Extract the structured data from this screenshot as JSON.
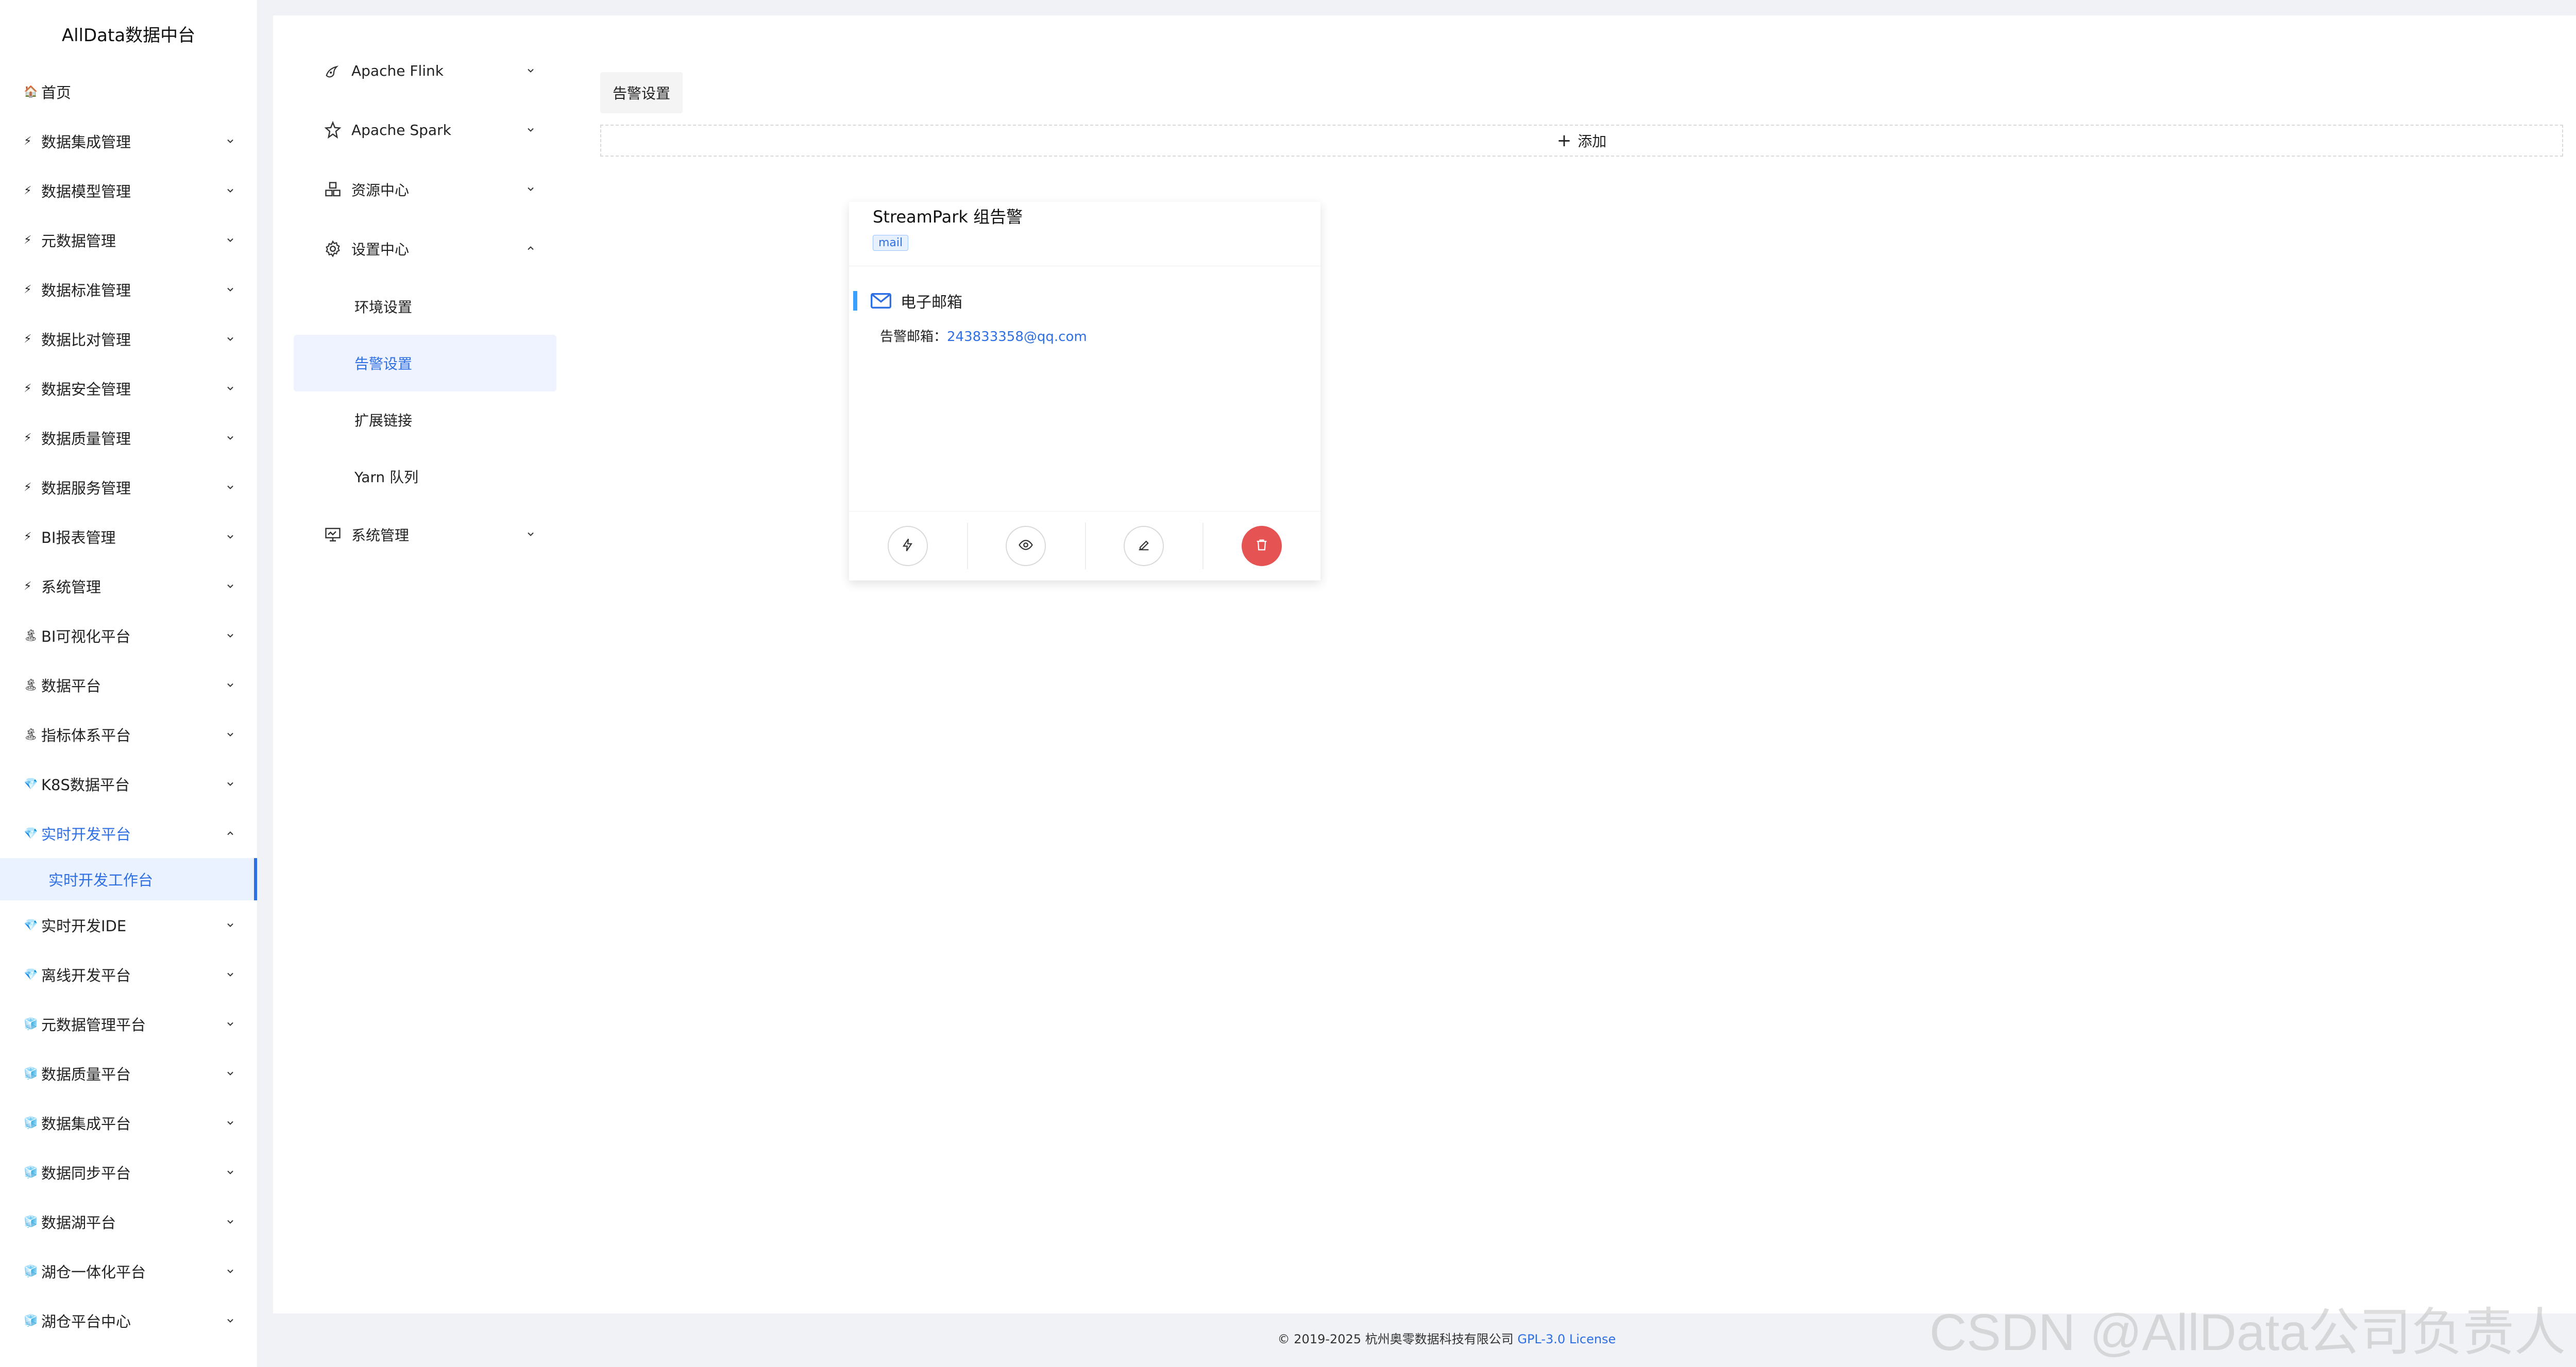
{
  "brand": "AllData数据中台",
  "sidebar": {
    "items": [
      {
        "label": "首页",
        "icon": "🏠",
        "has_chevron": false
      },
      {
        "label": "数据集成管理",
        "icon": "⚡",
        "has_chevron": true
      },
      {
        "label": "数据模型管理",
        "icon": "⚡",
        "has_chevron": true
      },
      {
        "label": "元数据管理",
        "icon": "⚡",
        "has_chevron": true
      },
      {
        "label": "数据标准管理",
        "icon": "⚡",
        "has_chevron": true
      },
      {
        "label": "数据比对管理",
        "icon": "⚡",
        "has_chevron": true
      },
      {
        "label": "数据安全管理",
        "icon": "⚡",
        "has_chevron": true
      },
      {
        "label": "数据质量管理",
        "icon": "⚡",
        "has_chevron": true
      },
      {
        "label": "数据服务管理",
        "icon": "⚡",
        "has_chevron": true
      },
      {
        "label": "BI报表管理",
        "icon": "⚡",
        "has_chevron": true
      },
      {
        "label": "系统管理",
        "icon": "⚡",
        "has_chevron": true
      },
      {
        "label": "BI可视化平台",
        "icon": "🏝",
        "has_chevron": true
      },
      {
        "label": "数据平台",
        "icon": "🏝",
        "has_chevron": true
      },
      {
        "label": "指标体系平台",
        "icon": "🏝",
        "has_chevron": true
      },
      {
        "label": "K8S数据平台",
        "icon": "💎",
        "has_chevron": true
      },
      {
        "label": "实时开发平台",
        "icon": "💎",
        "has_chevron": true,
        "expanded": true
      }
    ],
    "active_sub": "实时开发工作台",
    "items_after": [
      {
        "label": "实时开发IDE",
        "icon": "💎"
      },
      {
        "label": "离线开发平台",
        "icon": "💎"
      },
      {
        "label": "元数据管理平台",
        "icon": "🧊"
      },
      {
        "label": "数据质量平台",
        "icon": "🧊"
      },
      {
        "label": "数据集成平台",
        "icon": "🧊"
      },
      {
        "label": "数据同步平台",
        "icon": "🧊"
      },
      {
        "label": "数据湖平台",
        "icon": "🧊"
      },
      {
        "label": "湖仓一体化平台",
        "icon": "🧊"
      },
      {
        "label": "湖仓平台中心",
        "icon": "🧊"
      }
    ]
  },
  "submenu": {
    "flink": "Apache Flink",
    "spark": "Apache Spark",
    "resource": "资源中心",
    "settings": "设置中心",
    "children": [
      "环境设置",
      "告警设置",
      "扩展链接",
      "Yarn 队列"
    ],
    "system": "系统管理"
  },
  "panel": {
    "tab": "告警设置",
    "add": "添加",
    "card": {
      "title": "StreamPark 组告警",
      "tag": "mail",
      "type": "电子邮箱",
      "email_label": "告警邮箱：",
      "email": "243833358@qq.com"
    }
  },
  "footer": {
    "copyright": "© 2019-2025 杭州奥零数据科技有限公司 ",
    "license": "GPL-3.0 License"
  },
  "watermark": "CSDN @AllData公司负责人"
}
